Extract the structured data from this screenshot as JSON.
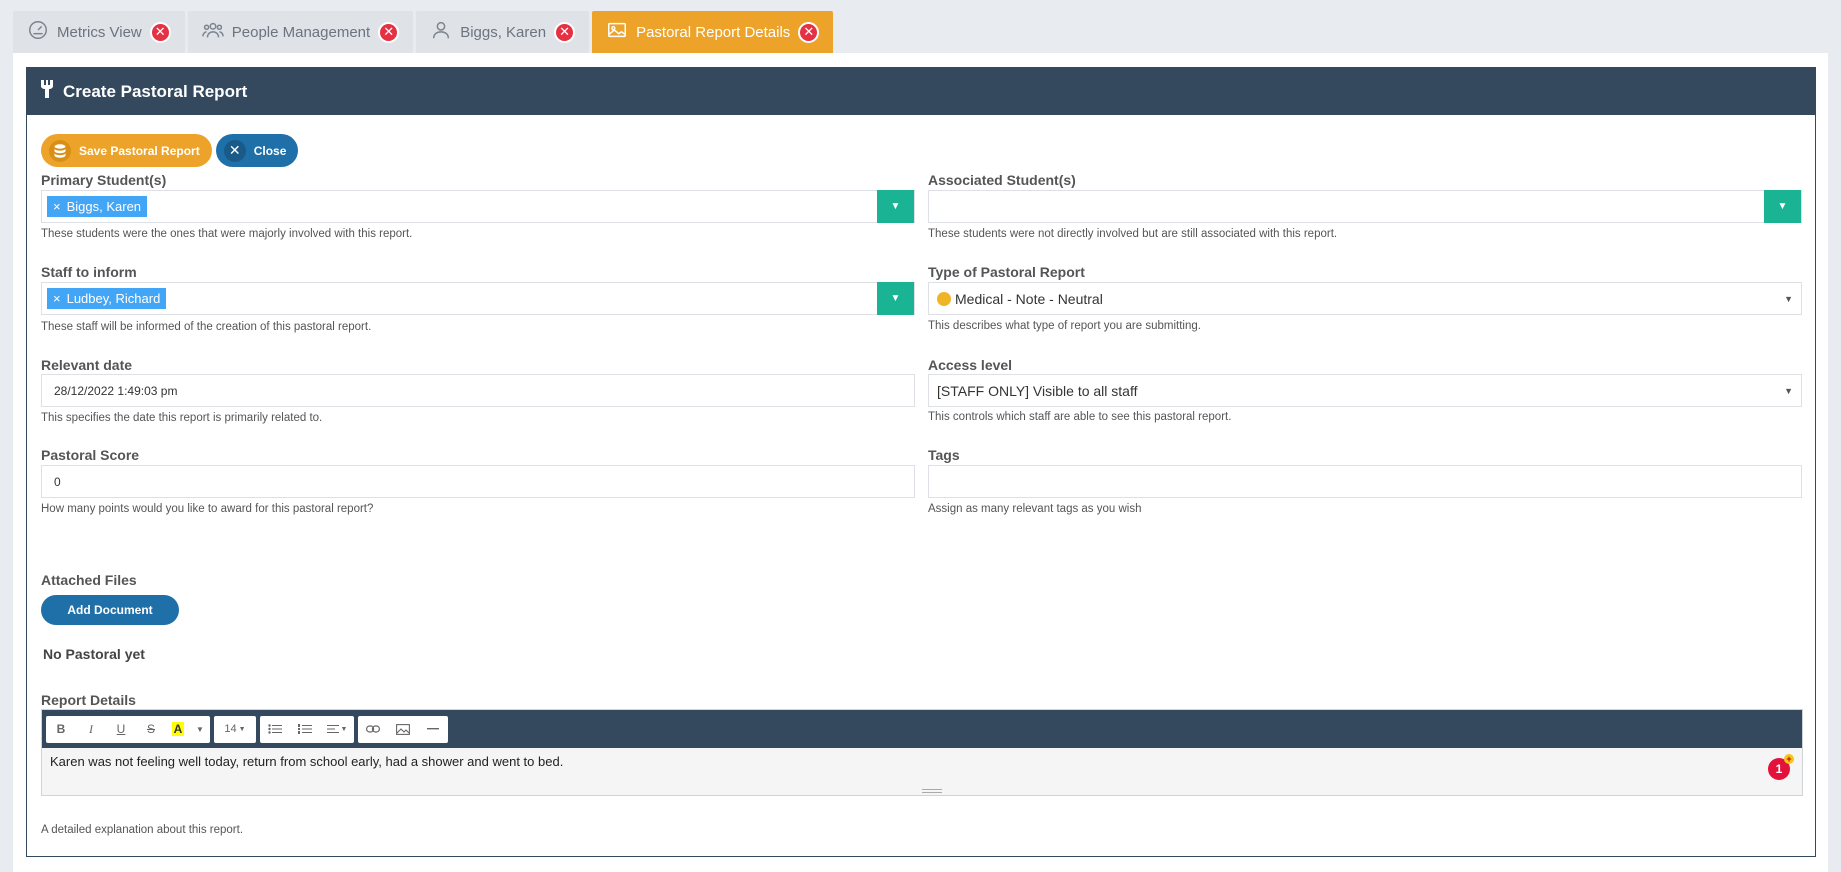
{
  "tabs": [
    {
      "label": "Metrics View",
      "icon": "gauge-icon",
      "active": false
    },
    {
      "label": "People Management",
      "icon": "users-icon",
      "active": false
    },
    {
      "label": "Biggs, Karen",
      "icon": "user-icon",
      "active": false
    },
    {
      "label": "Pastoral Report Details",
      "icon": "image-icon",
      "active": true
    }
  ],
  "card": {
    "title": "Create Pastoral Report"
  },
  "actions": {
    "save_label": "Save Pastoral Report",
    "close_label": "Close"
  },
  "primary_students": {
    "label": "Primary Student(s)",
    "chips": [
      "Biggs, Karen"
    ],
    "help": "These students were the ones that were majorly involved with this report."
  },
  "associated_students": {
    "label": "Associated Student(s)",
    "help": "These students were not directly involved but are still associated with this report."
  },
  "staff_inform": {
    "label": "Staff to inform",
    "chips": [
      "Ludbey, Richard"
    ],
    "help": "These staff will be informed of the creation of this pastoral report."
  },
  "report_type": {
    "label": "Type of Pastoral Report",
    "value": "Medical - Note - Neutral",
    "help": "This describes what type of report you are submitting."
  },
  "relevant_date": {
    "label": "Relevant date",
    "value": "28/12/2022 1:49:03 pm",
    "help": "This specifies the date this report is primarily related to."
  },
  "access_level": {
    "label": "Access level",
    "value": "[STAFF ONLY] Visible to all staff",
    "help": "This controls which staff are able to see this pastoral report."
  },
  "pastoral_score": {
    "label": "Pastoral Score",
    "value": "0",
    "help": "How many points would you like to award for this pastoral report?"
  },
  "tags": {
    "label": "Tags",
    "help": "Assign as many relevant tags as you wish"
  },
  "attachments": {
    "label": "Attached Files",
    "add_label": "Add Document",
    "empty_text": "No Pastoral yet"
  },
  "report_details": {
    "label": "Report Details",
    "toolbar": {
      "font_size": "14"
    },
    "body": "Karen was not feeling well today, return from school early, had a shower and went to bed.",
    "badge_count": "1",
    "help": "A detailed explanation about this report."
  },
  "colors": {
    "header": "#34495e",
    "accent_orange": "#eda32a",
    "accent_blue": "#1f6fa8",
    "accent_green": "#1ab394",
    "chip_blue": "#42a5f5",
    "close_red": "#e53143"
  }
}
